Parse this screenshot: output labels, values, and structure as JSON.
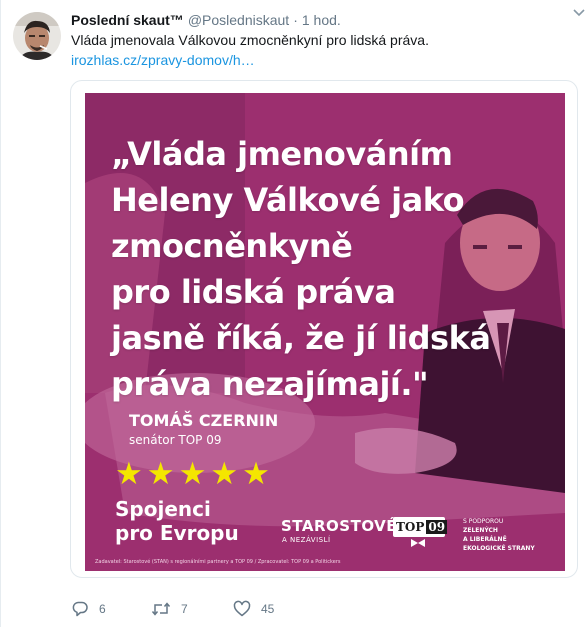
{
  "tweet": {
    "author_name": "Poslední skaut™",
    "handle": "@Posledniskaut",
    "separator": "·",
    "time": "1 hod.",
    "text": "Vláda jmenovala Válkovou zmocněnkyní pro lidská práva.",
    "link": "irozhlas.cz/zpravy-domov/h…"
  },
  "graphic": {
    "quote": "„Vláda jmenováním\nHeleny Válkové jako\nzmocněnkyně\npro lidská práva\njasně říká, že jí lidská\npráva nezajímají.\"",
    "author": "TOMÁŠ CZERNIN",
    "role": "senátor TOP 09",
    "stars": "★★★★★",
    "party": "Spojenci\npro Evropu",
    "starostove": "STAROSTOVÉ",
    "nezavisli": "A NEZÁVISLÍ",
    "top09_text": "TOP",
    "top09_num": "09",
    "support_line1": "S PODPOROU",
    "support_rest": "ZELENÝCH\nA LIBERÁLNĚ\nEKOLOGICKÉ STRANY",
    "footnote": "Zadavatel: Starostové (STAN) s regionálními partnery a TOP 09 / Zpracovatel: TOP 09 a Politickers",
    "colors": {
      "overlay": "#a8357a",
      "stars": "#f4e600"
    }
  },
  "actions": {
    "replies": "6",
    "retweets": "7",
    "likes": "45"
  },
  "icons": {
    "reply": "reply-icon",
    "retweet": "retweet-icon",
    "like": "heart-icon",
    "more": "chevron-down-icon"
  }
}
